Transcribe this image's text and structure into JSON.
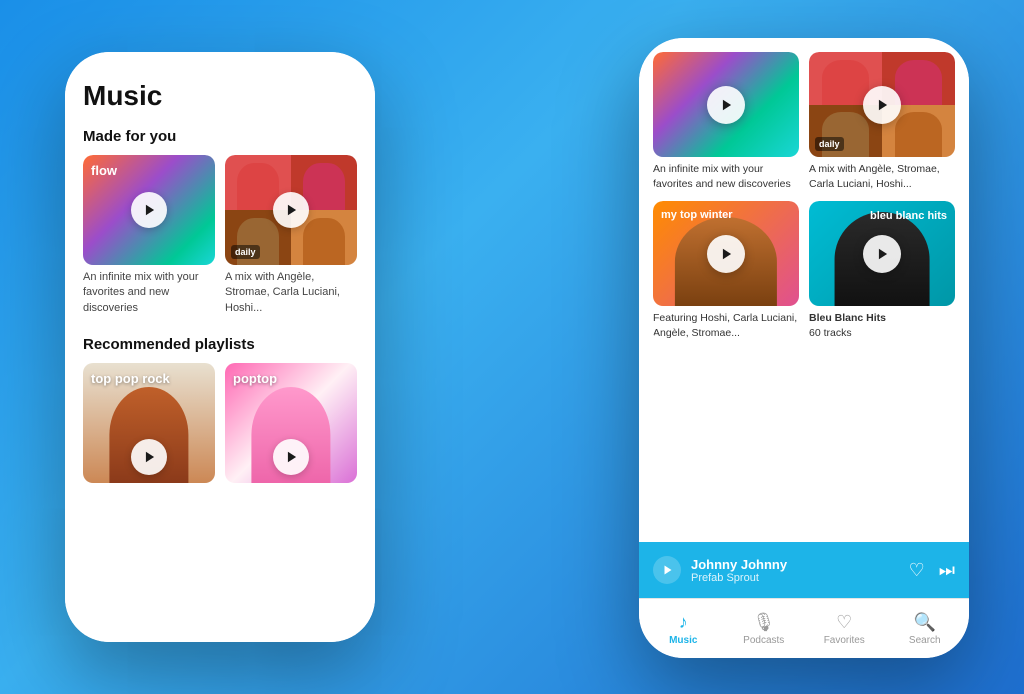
{
  "background": "#2a8ee8",
  "phone_left": {
    "title": "Music",
    "made_for_you_label": "Made for you",
    "flow_label": "flow",
    "flow_desc": "An infinite mix with your favorites and new discoveries",
    "daily_label": "daily",
    "daily_desc": "A mix with Angèle, Stromae, Carla Luciani, Hoshi...",
    "recommended_label": "Recommended playlists",
    "playlist1_label": "top pop rock",
    "playlist2_label": "poptop"
  },
  "phone_right": {
    "card1_desc": "An infinite mix with your favorites and new discoveries",
    "card2_daily_label": "daily",
    "card2_desc": "A mix with Angèle, Stromae, Carla Luciani, Hoshi...",
    "winter_label": "my top winter",
    "winter_desc": "Featuring Hoshi, Carla Luciani, Angèle, Stromae...",
    "bleu_label": "bleu blanc hits",
    "bleu_desc": "Bleu Blanc Hits",
    "bleu_tracks": "60 tracks",
    "now_playing_title": "Johnny Johnny",
    "now_playing_artist": "Prefab Sprout",
    "tab_music": "Music",
    "tab_podcasts": "Podcasts",
    "tab_favorites": "Favorites",
    "tab_search": "Search"
  }
}
